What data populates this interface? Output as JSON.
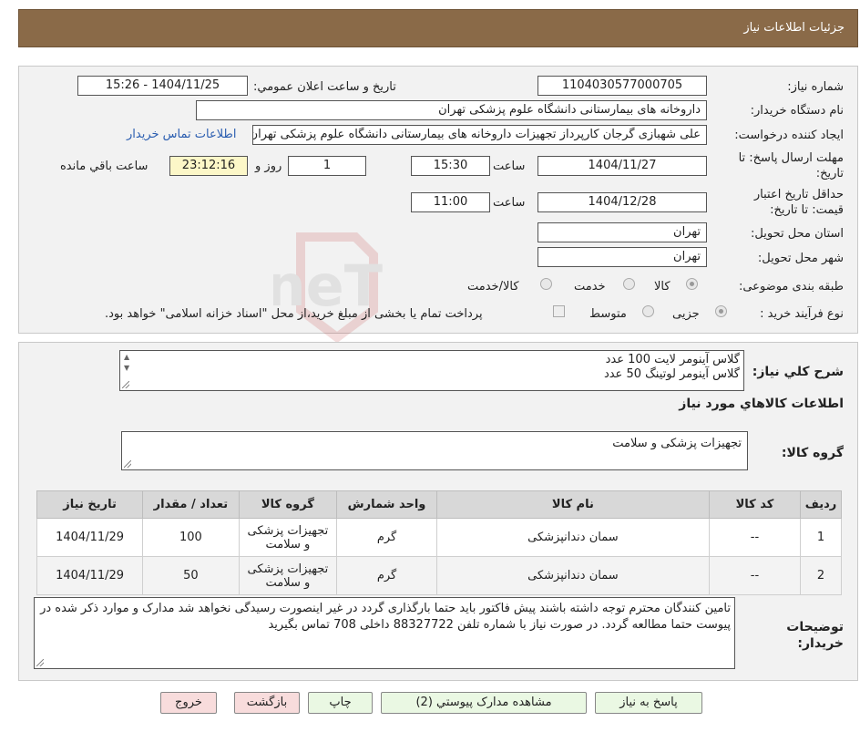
{
  "header": {
    "title": "جزئیات اطلاعات نیاز"
  },
  "fields": {
    "need_number_label": "شماره نیاز:",
    "need_number": "1104030577000705",
    "announce_label": "تاریخ و ساعت اعلان عمومي:",
    "announce_value": "1404/11/25 - 15:26",
    "buyer_org_label": "نام دستگاه خریدار:",
    "buyer_org": "داروخانه های بیمارستانی دانشگاه علوم پزشکی تهران",
    "creator_label": "ایجاد کننده درخواست:",
    "creator": "علی شهبازی گرجان کارپرداز تجهیزات داروخانه های بیمارستانی دانشگاه علوم پزشکی تهران",
    "contact_link": "اطلاعات تماس خریدار",
    "deadline_label_1": "مهلت ارسال پاسخ: تا",
    "deadline_label_2": "تاریخ:",
    "deadline_date": "1404/11/27",
    "time_label": "ساعت",
    "deadline_time": "15:30",
    "days_value": "1",
    "days_label": "روز و",
    "remaining_time": "23:12:16",
    "remaining_label": "ساعت باقي مانده",
    "validity_label_1": "حداقل تاریخ اعتبار",
    "validity_label_2": "قیمت: تا تاریخ:",
    "validity_date": "1404/12/28",
    "validity_time_label": "ساعت",
    "validity_time": "11:00",
    "province_label": "استان محل تحویل:",
    "province": "تهران",
    "city_label": "شهر محل تحویل:",
    "city": "تهران",
    "category_label": "طبقه بندی موضوعی:",
    "category_options": [
      "کالا",
      "خدمت",
      "کالا/خدمت"
    ],
    "process_label": "نوع فرآیند خرید :",
    "process_options": [
      "جزیی",
      "متوسط"
    ],
    "process_note": "پرداخت تمام یا بخشی از مبلغ خرید،از محل \"اسناد خزانه اسلامی\" خواهد بود."
  },
  "summary": {
    "label": "شرح کلي نیاز:",
    "lines": [
      "گلاس آینومر لایت 100 عدد",
      "گلاس آینومر لوتینگ 50 عدد"
    ]
  },
  "goods_info_title": "اطلاعات کالاهاي مورد نیاز",
  "goods_group": {
    "label": "گروه کالا:",
    "value": "تجهیزات پزشکی و سلامت"
  },
  "table": {
    "headers": [
      "ردیف",
      "کد کالا",
      "نام کالا",
      "واحد شمارش",
      "گروه کالا",
      "تعداد / مقدار",
      "تاریخ نیاز"
    ],
    "rows": [
      [
        "1",
        "--",
        "سمان دندانپزشکی",
        "گرم",
        "تجهیزات پزشکی و سلامت",
        "100",
        "1404/11/29"
      ],
      [
        "2",
        "--",
        "سمان دندانپزشکی",
        "گرم",
        "تجهیزات پزشکی و سلامت",
        "50",
        "1404/11/29"
      ]
    ]
  },
  "notes": {
    "label_1": "توضیحات",
    "label_2": "خریدار:",
    "text": "تامین کنندگان محترم توجه داشته باشند پیش فاکتور باید حتما بارگذاری گردد در غیر اینصورت رسیدگی نخواهد شد مدارک و موارد ذکر شده در پیوست حتما مطالعه گردد. در صورت نیاز با شماره تلفن 88327722 داخلی 708 تماس بگیرید"
  },
  "buttons": {
    "reply": "پاسخ به نیاز",
    "attachments": "مشاهده مدارک پیوستي (2)",
    "print": "چاپ",
    "back": "بازگشت",
    "exit": "خروج"
  },
  "watermark": {
    "text": "AriaTender.neT"
  },
  "colors": {
    "header_bg": "#8a6a48",
    "button_green": "#eaf8e3",
    "button_pink": "#f8dcdc",
    "link": "#2a5db0"
  }
}
